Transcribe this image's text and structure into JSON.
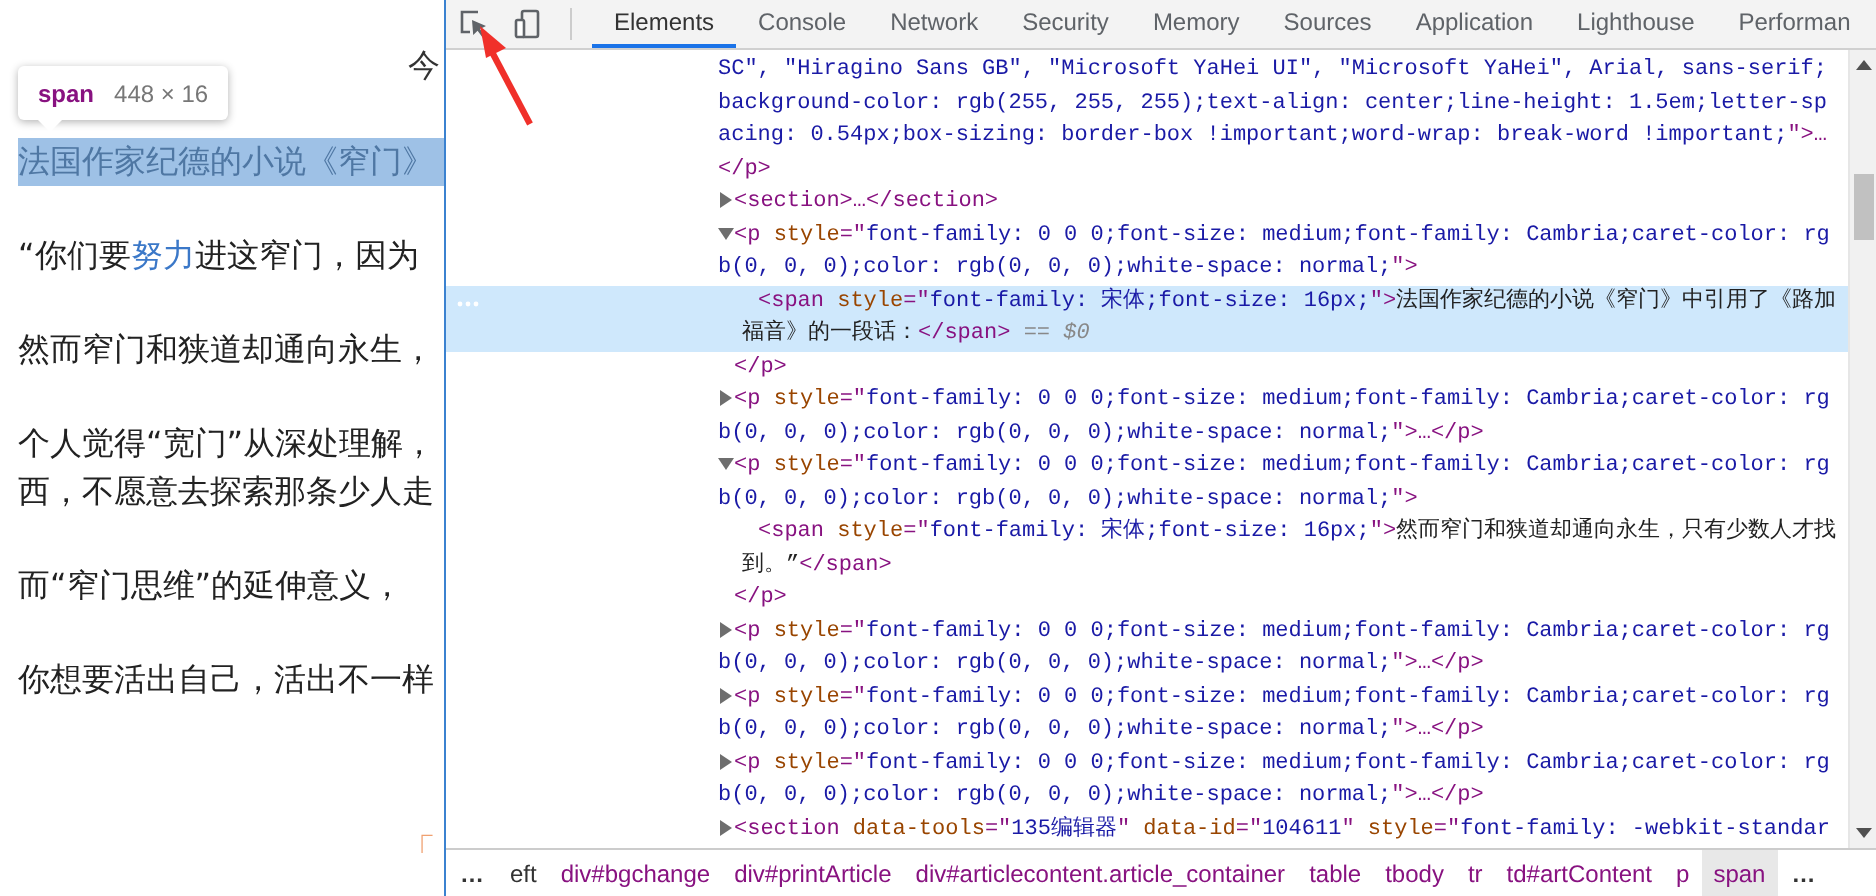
{
  "page": {
    "header_fragment": "今",
    "tooltip": {
      "tag": "span",
      "size": "448 × 16"
    },
    "paragraphs": [
      {
        "highlighted": true,
        "lines": [
          [
            {
              "kind": "plain",
              "text": "法国作家纪德的小说《窄门》"
            }
          ]
        ]
      },
      {
        "highlighted": false,
        "lines": [
          [
            {
              "kind": "plain",
              "text": "“你们要"
            },
            {
              "kind": "link",
              "text": "努力"
            },
            {
              "kind": "plain",
              "text": "进这窄门，因为"
            }
          ]
        ]
      },
      {
        "highlighted": false,
        "lines": [
          [
            {
              "kind": "plain",
              "text": "然而窄门和狭道却通向永生，"
            }
          ]
        ]
      },
      {
        "highlighted": false,
        "lines": [
          [
            {
              "kind": "plain",
              "text": "个人觉得“宽门”从深处理解，"
            }
          ],
          [
            {
              "kind": "plain",
              "text": "西，不愿意去探索那条少人走"
            }
          ]
        ]
      },
      {
        "highlighted": false,
        "lines": [
          [
            {
              "kind": "plain",
              "text": "而“窄门思维”的延伸意义，"
            }
          ]
        ]
      },
      {
        "highlighted": false,
        "lines": [
          [
            {
              "kind": "plain",
              "text": "你想要活出自己，活出不一样"
            }
          ]
        ]
      }
    ],
    "footer_fragment": "「"
  },
  "devtools": {
    "tabs": [
      {
        "label": "Elements",
        "selected": true
      },
      {
        "label": "Console",
        "selected": false
      },
      {
        "label": "Network",
        "selected": false
      },
      {
        "label": "Security",
        "selected": false
      },
      {
        "label": "Memory",
        "selected": false
      },
      {
        "label": "Sources",
        "selected": false
      },
      {
        "label": "Application",
        "selected": false
      },
      {
        "label": "Lighthouse",
        "selected": false
      },
      {
        "label": "Performan",
        "selected": false
      }
    ],
    "tree": [
      {
        "kind": "fragment",
        "selected": false,
        "open": [
          {
            "kind": "value",
            "text": "SC\", \"Hiragino Sans GB\", \"Microsoft YaHei UI\", \"Microsoft YaHei\", Arial, sans-serif;background-color: rgb(255, 255, 255);text-align: center;line-height: 1.5em;letter-spacing: 0.54px;box-sizing: border-box !important;word-wrap: break-word !important;"
          },
          {
            "kind": "tag",
            "text": "\">…"
          }
        ],
        "close": [
          {
            "kind": "tag",
            "text": "</p>"
          }
        ]
      },
      {
        "kind": "element",
        "expanded": false,
        "selected": false,
        "open": [
          {
            "kind": "tag",
            "text": "<section>…</section>"
          }
        ]
      },
      {
        "kind": "element",
        "expanded": true,
        "selected": false,
        "open": [
          {
            "kind": "tag",
            "text": "<p "
          },
          {
            "kind": "attr",
            "text": "style"
          },
          {
            "kind": "tag",
            "text": "=\""
          },
          {
            "kind": "value",
            "text": "font-family: 0 0 0;font-size: medium;font-family: Cambria;caret-color: rgb(0, 0, 0);color: rgb(0, 0, 0);white-space: normal;"
          },
          {
            "kind": "tag",
            "text": "\">"
          }
        ],
        "close": [
          {
            "kind": "tag",
            "text": "</p>"
          }
        ],
        "children": [
          {
            "kind": "fragment",
            "selected": true,
            "open": [
              {
                "kind": "tag",
                "text": "<span "
              },
              {
                "kind": "attr",
                "text": "style"
              },
              {
                "kind": "tag",
                "text": "=\""
              },
              {
                "kind": "value",
                "text": "font-family: 宋体;font-size: 16px;"
              },
              {
                "kind": "tag",
                "text": "\">"
              },
              {
                "kind": "text",
                "text": "法国作家纪德的小说《窄门》中引用了《路加福音》的一段话："
              },
              {
                "kind": "tag",
                "text": "</span>"
              },
              {
                "kind": "marker",
                "text": " == $0"
              }
            ]
          }
        ]
      },
      {
        "kind": "element",
        "expanded": false,
        "selected": false,
        "open": [
          {
            "kind": "tag",
            "text": "<p "
          },
          {
            "kind": "attr",
            "text": "style"
          },
          {
            "kind": "tag",
            "text": "=\""
          },
          {
            "kind": "value",
            "text": "font-family: 0 0 0;font-size: medium;font-family: Cambria;caret-color: rgb(0, 0, 0);color: rgb(0, 0, 0);white-space: normal;"
          },
          {
            "kind": "tag",
            "text": "\">…</p>"
          }
        ]
      },
      {
        "kind": "element",
        "expanded": true,
        "selected": false,
        "open": [
          {
            "kind": "tag",
            "text": "<p "
          },
          {
            "kind": "attr",
            "text": "style"
          },
          {
            "kind": "tag",
            "text": "=\""
          },
          {
            "kind": "value",
            "text": "font-family: 0 0 0;font-size: medium;font-family: Cambria;caret-color: rgb(0, 0, 0);color: rgb(0, 0, 0);white-space: normal;"
          },
          {
            "kind": "tag",
            "text": "\">"
          }
        ],
        "close": [
          {
            "kind": "tag",
            "text": "</p>"
          }
        ],
        "children": [
          {
            "kind": "fragment",
            "selected": false,
            "open": [
              {
                "kind": "tag",
                "text": "<span "
              },
              {
                "kind": "attr",
                "text": "style"
              },
              {
                "kind": "tag",
                "text": "=\""
              },
              {
                "kind": "value",
                "text": "font-family: 宋体;font-size: 16px;"
              },
              {
                "kind": "tag",
                "text": "\">"
              },
              {
                "kind": "text",
                "text": "然而窄门和狭道却通向永生，只有少数人才找到。”"
              },
              {
                "kind": "tag",
                "text": "</span>"
              }
            ]
          }
        ]
      },
      {
        "kind": "element",
        "expanded": false,
        "selected": false,
        "open": [
          {
            "kind": "tag",
            "text": "<p "
          },
          {
            "kind": "attr",
            "text": "style"
          },
          {
            "kind": "tag",
            "text": "=\""
          },
          {
            "kind": "value",
            "text": "font-family: 0 0 0;font-size: medium;font-family: Cambria;caret-color: rgb(0, 0, 0);color: rgb(0, 0, 0);white-space: normal;"
          },
          {
            "kind": "tag",
            "text": "\">…</p>"
          }
        ]
      },
      {
        "kind": "element",
        "expanded": false,
        "selected": false,
        "open": [
          {
            "kind": "tag",
            "text": "<p "
          },
          {
            "kind": "attr",
            "text": "style"
          },
          {
            "kind": "tag",
            "text": "=\""
          },
          {
            "kind": "value",
            "text": "font-family: 0 0 0;font-size: medium;font-family: Cambria;caret-color: rgb(0, 0, 0);color: rgb(0, 0, 0);white-space: normal;"
          },
          {
            "kind": "tag",
            "text": "\">…</p>"
          }
        ]
      },
      {
        "kind": "element",
        "expanded": false,
        "selected": false,
        "open": [
          {
            "kind": "tag",
            "text": "<p "
          },
          {
            "kind": "attr",
            "text": "style"
          },
          {
            "kind": "tag",
            "text": "=\""
          },
          {
            "kind": "value",
            "text": "font-family: 0 0 0;font-size: medium;font-family: Cambria;caret-color: rgb(0, 0, 0);color: rgb(0, 0, 0);white-space: normal;"
          },
          {
            "kind": "tag",
            "text": "\">…</p>"
          }
        ]
      },
      {
        "kind": "element",
        "expanded": false,
        "selected": false,
        "open": [
          {
            "kind": "tag",
            "text": "<section "
          },
          {
            "kind": "attr",
            "text": "data-tools"
          },
          {
            "kind": "tag",
            "text": "=\""
          },
          {
            "kind": "value",
            "text": "135编辑器"
          },
          {
            "kind": "tag",
            "text": "\" "
          },
          {
            "kind": "attr",
            "text": "data-id"
          },
          {
            "kind": "tag",
            "text": "=\""
          },
          {
            "kind": "value",
            "text": "104611"
          },
          {
            "kind": "tag",
            "text": "\" "
          },
          {
            "kind": "attr",
            "text": "style"
          },
          {
            "kind": "tag",
            "text": "=\""
          },
          {
            "kind": "value",
            "text": "font-family: -webkit-standar"
          }
        ]
      }
    ],
    "breadcrumbs": {
      "leading": "…",
      "trailing": "…",
      "items": [
        {
          "label": "eft",
          "selected": false
        },
        {
          "label": "div#bgchange",
          "selected": false
        },
        {
          "label": "div#printArticle",
          "selected": false
        },
        {
          "label": "div#articlecontent.article_container",
          "selected": false
        },
        {
          "label": "table",
          "selected": false
        },
        {
          "label": "tbody",
          "selected": false
        },
        {
          "label": "tr",
          "selected": false
        },
        {
          "label": "td#artContent",
          "selected": false
        },
        {
          "label": "p",
          "selected": false
        },
        {
          "label": "span",
          "selected": true
        }
      ]
    }
  }
}
